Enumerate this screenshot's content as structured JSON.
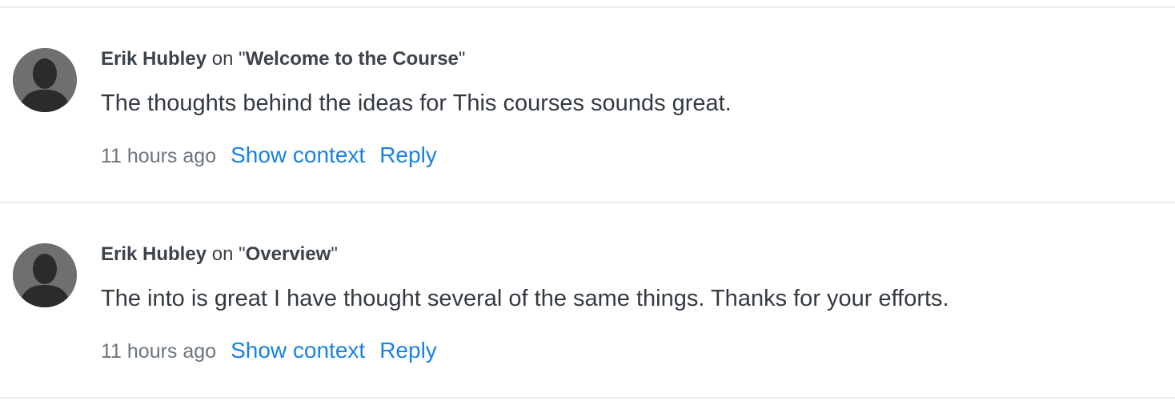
{
  "comments": [
    {
      "author": "Erik Hubley",
      "on_prefix": " on \"",
      "lesson": "Welcome to the Course",
      "on_suffix": "\"",
      "body": "The thoughts behind the ideas for This courses sounds great.",
      "time": "11 hours ago",
      "show_context_label": "Show context",
      "reply_label": "Reply"
    },
    {
      "author": "Erik Hubley",
      "on_prefix": " on \"",
      "lesson": "Overview",
      "on_suffix": "\"",
      "body": "The into is great I have thought several of the same things. Thanks for your efforts.",
      "time": "11 hours ago",
      "show_context_label": "Show context",
      "reply_label": "Reply"
    }
  ],
  "colors": {
    "link": "#1a82e2",
    "muted": "#6c757d",
    "text": "#333a42",
    "divider": "#e6e8ea",
    "avatar_bg": "#6f6f6f"
  },
  "icons": {
    "avatar": "default-user-silhouette-icon"
  }
}
